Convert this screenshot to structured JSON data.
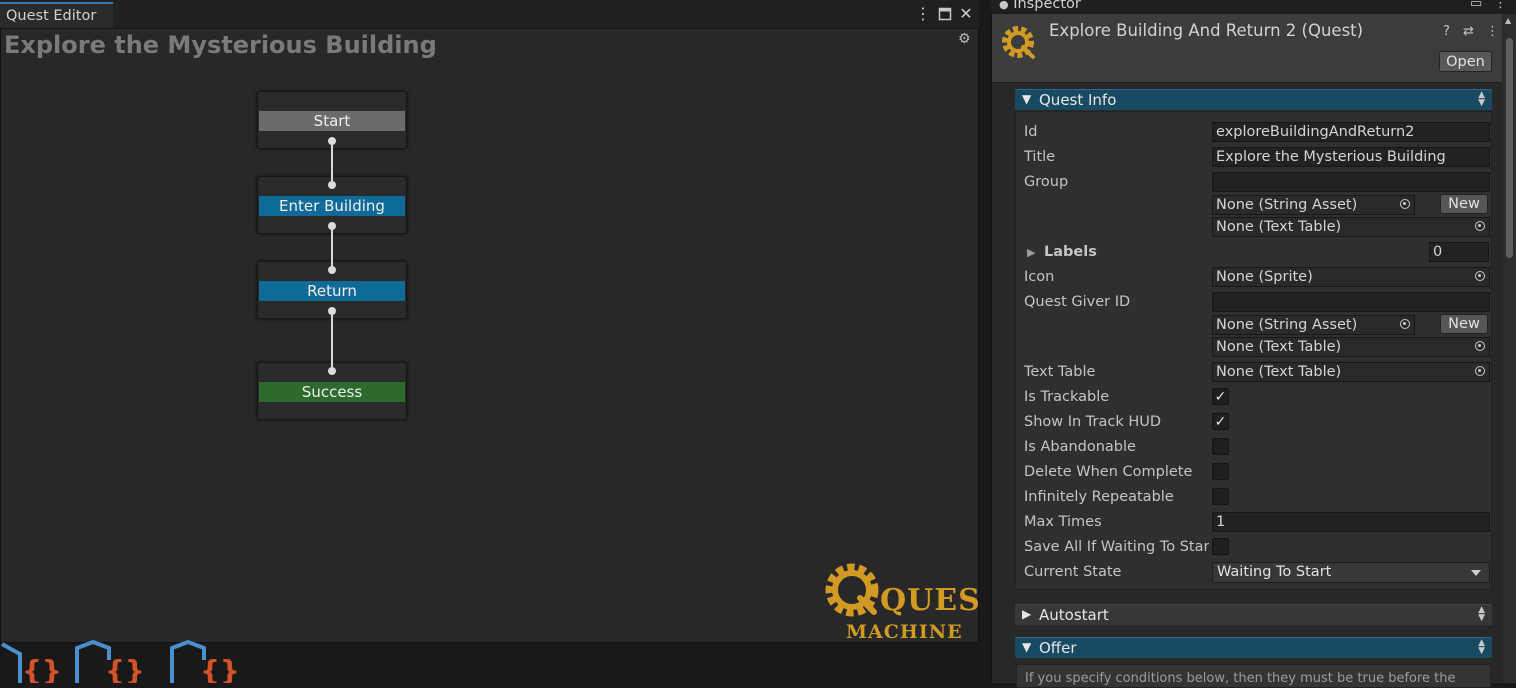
{
  "quest_editor": {
    "tab_label": "Quest Editor",
    "quest_title": "Explore the Mysterious Building",
    "nodes": [
      {
        "label": "Start",
        "color": "#6b6b6b"
      },
      {
        "label": "Enter Building",
        "color": "#0e6a99"
      },
      {
        "label": "Return",
        "color": "#0e6a99"
      },
      {
        "label": "Success",
        "color": "#2d6b2d"
      }
    ],
    "logo_text": {
      "word1": "QUEST",
      "word2": "MACHINE"
    },
    "toolbar_icons": [
      "more-icon",
      "maximize-icon",
      "close-icon",
      "gear-icon"
    ]
  },
  "inspector": {
    "tab_label": "Inspector",
    "object_name": "Explore Building And Return 2 (Quest)",
    "open_button": "Open",
    "header_icons": [
      "help-icon",
      "preset-icon",
      "more-icon"
    ],
    "quest_info": {
      "section_label": "Quest Info",
      "id_label": "Id",
      "id_value": "exploreBuildingAndReturn2",
      "title_label": "Title",
      "title_value": "Explore the Mysterious Building",
      "group_label": "Group",
      "group_value": "",
      "group_string_asset": "None (String Asset)",
      "group_text_table": "None (Text Table)",
      "new_label": "New",
      "labels_label": "Labels",
      "labels_count": "0",
      "icon_label": "Icon",
      "icon_value": "None (Sprite)",
      "quest_giver_label": "Quest Giver ID",
      "quest_giver_value": "",
      "quest_giver_string_asset": "None (String Asset)",
      "quest_giver_text_table": "None (Text Table)",
      "text_table_label": "Text Table",
      "text_table_value": "None (Text Table)",
      "is_trackable_label": "Is Trackable",
      "is_trackable": true,
      "show_in_track_hud_label": "Show In Track HUD",
      "show_in_track_hud": true,
      "is_abandonable_label": "Is Abandonable",
      "is_abandonable": false,
      "delete_when_complete_label": "Delete When Complete",
      "delete_when_complete": false,
      "infinitely_repeatable_label": "Infinitely Repeatable",
      "infinitely_repeatable": false,
      "max_times_label": "Max Times",
      "max_times_value": "1",
      "save_all_label": "Save All If Waiting To Star",
      "save_all": false,
      "current_state_label": "Current State",
      "current_state_value": "Waiting To Start"
    },
    "autostart": {
      "section_label": "Autostart"
    },
    "offer": {
      "section_label": "Offer",
      "help_text": "If you specify conditions below, then they must be true before the"
    }
  }
}
